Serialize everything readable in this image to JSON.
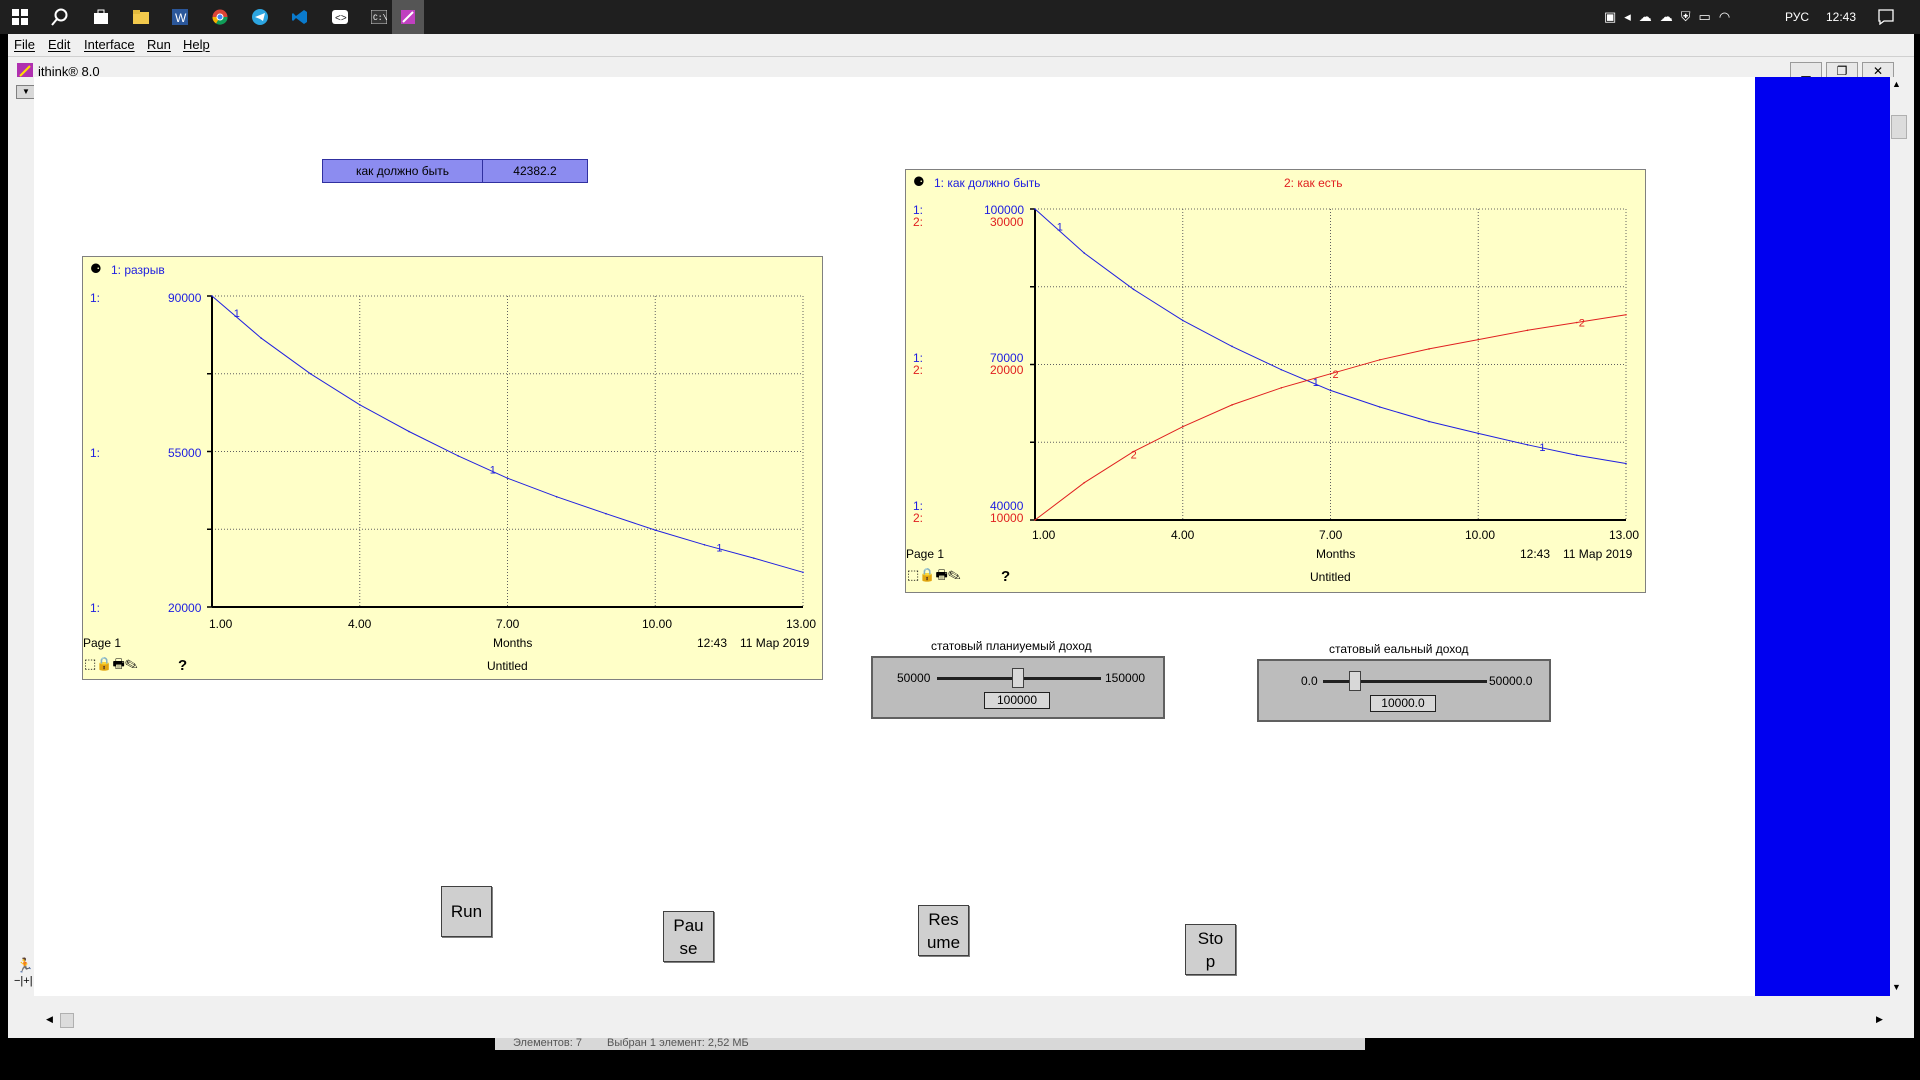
{
  "taskbar": {
    "icons": [
      "windows-logo-icon",
      "search-icon",
      "store-icon",
      "file-explorer-icon",
      "word-icon",
      "chrome-icon",
      "telegram-icon",
      "vscode-icon",
      "app-icon",
      "terminal-icon",
      "ithink-icon"
    ],
    "lang": "РУС",
    "time": "12:43"
  },
  "menu": [
    "File",
    "Edit",
    "Interface",
    "Run",
    "Help"
  ],
  "window": {
    "title": "ithink® 8.0"
  },
  "numeric_display": {
    "label": "как должно быть",
    "value": "42382.2"
  },
  "graph1": {
    "legend": "1: разрыв",
    "y_ticks": [
      "90000",
      "55000",
      "20000"
    ],
    "y_prefix": "1:",
    "x_ticks": [
      "1.00",
      "4.00",
      "7.00",
      "10.00",
      "13.00"
    ],
    "page": "Page 1",
    "xlabel": "Months",
    "time": "12:43",
    "date": "11 Мар 2019",
    "doc": "Untitled",
    "help": "?"
  },
  "graph2": {
    "legend1": "1: как должно быть",
    "legend2": "2: как есть",
    "y_left_top": [
      "1:",
      "2:"
    ],
    "y1_ticks": [
      "100000",
      "70000",
      "40000"
    ],
    "y2_ticks": [
      "30000",
      "20000",
      "10000"
    ],
    "x_ticks": [
      "1.00",
      "4.00",
      "7.00",
      "10.00",
      "13.00"
    ],
    "page": "Page 1",
    "xlabel": "Months",
    "time": "12:43",
    "date": "11 Мар 2019",
    "doc": "Untitled",
    "help": "?"
  },
  "slider1": {
    "title": "статовый планиуемый доход",
    "min": "50000",
    "max": "150000",
    "value": "100000"
  },
  "slider2": {
    "title": "статовый еальный доход",
    "min": "0.0",
    "max": "50000.0",
    "value": "10000.0"
  },
  "buttons": {
    "run": "Run",
    "pause": "Pau\nse",
    "resume": "Res\nume",
    "stop": "Sto\np"
  },
  "statusbar": {
    "left": "Элементов: 7",
    "right": "Выбран 1 элемент: 2,52 МБ"
  },
  "colors": {
    "series1": "#2020e0",
    "series2": "#e02020",
    "graph_bg": "#ffffc8",
    "blue_panel": "#0000f0"
  },
  "chart_data": [
    {
      "type": "line",
      "title": "",
      "xlabel": "Months",
      "ylabel": "",
      "xlim": [
        1,
        13
      ],
      "ylim": [
        20000,
        90000
      ],
      "series": [
        {
          "name": "1: разрыв",
          "x": [
            1,
            2,
            3,
            4,
            5,
            6,
            7,
            8,
            9,
            10,
            11,
            12,
            13
          ],
          "values": [
            90000,
            80500,
            72500,
            65500,
            59500,
            54000,
            49000,
            44800,
            41000,
            37300,
            34000,
            31000,
            27800
          ]
        }
      ]
    },
    {
      "type": "line",
      "title": "",
      "xlabel": "Months",
      "ylabel": "",
      "xlim": [
        1,
        13
      ],
      "series": [
        {
          "name": "1: как должно быть",
          "axis": "y1",
          "ylim": [
            40000,
            100000
          ],
          "x": [
            1,
            2,
            3,
            4,
            5,
            6,
            7,
            8,
            9,
            10,
            11,
            12,
            13
          ],
          "values": [
            100000,
            91500,
            84500,
            78500,
            73500,
            69000,
            65000,
            61800,
            59000,
            56700,
            54500,
            52500,
            50900
          ]
        },
        {
          "name": "2: как есть",
          "axis": "y2",
          "ylim": [
            10000,
            30000
          ],
          "x": [
            1,
            2,
            3,
            4,
            5,
            6,
            7,
            8,
            9,
            10,
            11,
            12,
            13
          ],
          "values": [
            10000,
            12400,
            14400,
            16000,
            17400,
            18500,
            19400,
            20300,
            21000,
            21600,
            22200,
            22700,
            23200
          ]
        }
      ]
    }
  ]
}
